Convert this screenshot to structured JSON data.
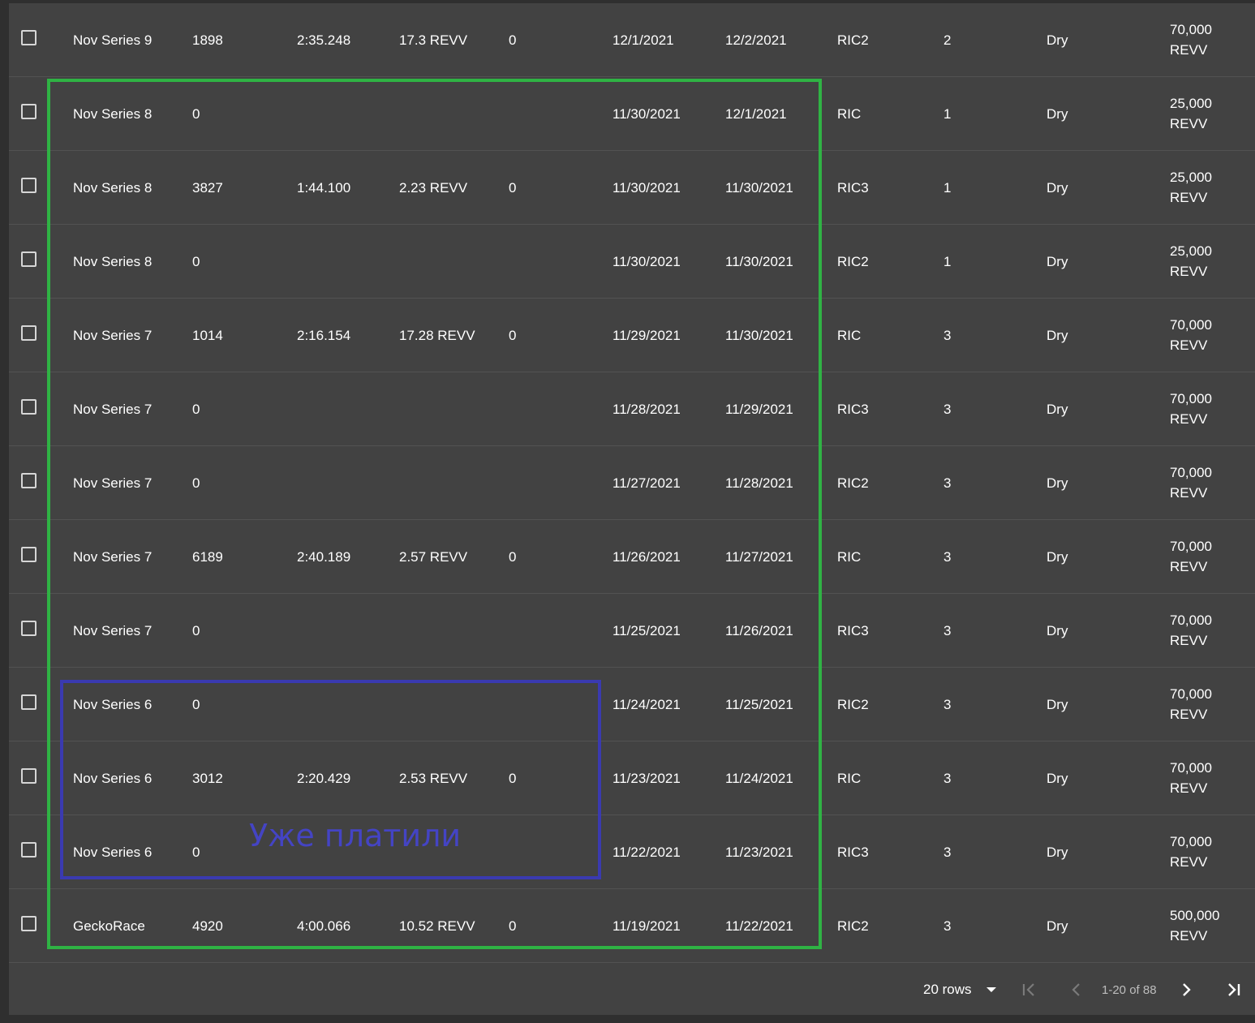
{
  "rows": [
    {
      "name": "Nov Series 9",
      "score": "1898",
      "time": "2:35.248",
      "reward": "17.3 REVV",
      "zero": "0",
      "start": "12/1/2021",
      "end": "12/2/2021",
      "track": "RIC2",
      "laps": "2",
      "weather": "Dry",
      "prize": "70,000 REVV"
    },
    {
      "name": "Nov Series 8",
      "score": "0",
      "time": "",
      "reward": "",
      "zero": "",
      "start": "11/30/2021",
      "end": "12/1/2021",
      "track": "RIC",
      "laps": "1",
      "weather": "Dry",
      "prize": "25,000 REVV"
    },
    {
      "name": "Nov Series 8",
      "score": "3827",
      "time": "1:44.100",
      "reward": "2.23 REVV",
      "zero": "0",
      "start": "11/30/2021",
      "end": "11/30/2021",
      "track": "RIC3",
      "laps": "1",
      "weather": "Dry",
      "prize": "25,000 REVV"
    },
    {
      "name": "Nov Series 8",
      "score": "0",
      "time": "",
      "reward": "",
      "zero": "",
      "start": "11/30/2021",
      "end": "11/30/2021",
      "track": "RIC2",
      "laps": "1",
      "weather": "Dry",
      "prize": "25,000 REVV"
    },
    {
      "name": "Nov Series 7",
      "score": "1014",
      "time": "2:16.154",
      "reward": "17.28 REVV",
      "zero": "0",
      "start": "11/29/2021",
      "end": "11/30/2021",
      "track": "RIC",
      "laps": "3",
      "weather": "Dry",
      "prize": "70,000 REVV"
    },
    {
      "name": "Nov Series 7",
      "score": "0",
      "time": "",
      "reward": "",
      "zero": "",
      "start": "11/28/2021",
      "end": "11/29/2021",
      "track": "RIC3",
      "laps": "3",
      "weather": "Dry",
      "prize": "70,000 REVV"
    },
    {
      "name": "Nov Series 7",
      "score": "0",
      "time": "",
      "reward": "",
      "zero": "",
      "start": "11/27/2021",
      "end": "11/28/2021",
      "track": "RIC2",
      "laps": "3",
      "weather": "Dry",
      "prize": "70,000 REVV"
    },
    {
      "name": "Nov Series 7",
      "score": "6189",
      "time": "2:40.189",
      "reward": "2.57 REVV",
      "zero": "0",
      "start": "11/26/2021",
      "end": "11/27/2021",
      "track": "RIC",
      "laps": "3",
      "weather": "Dry",
      "prize": "70,000 REVV"
    },
    {
      "name": "Nov Series 7",
      "score": "0",
      "time": "",
      "reward": "",
      "zero": "",
      "start": "11/25/2021",
      "end": "11/26/2021",
      "track": "RIC3",
      "laps": "3",
      "weather": "Dry",
      "prize": "70,000 REVV"
    },
    {
      "name": "Nov Series 6",
      "score": "0",
      "time": "",
      "reward": "",
      "zero": "",
      "start": "11/24/2021",
      "end": "11/25/2021",
      "track": "RIC2",
      "laps": "3",
      "weather": "Dry",
      "prize": "70,000 REVV"
    },
    {
      "name": "Nov Series 6",
      "score": "3012",
      "time": "2:20.429",
      "reward": "2.53 REVV",
      "zero": "0",
      "start": "11/23/2021",
      "end": "11/24/2021",
      "track": "RIC",
      "laps": "3",
      "weather": "Dry",
      "prize": "70,000 REVV"
    },
    {
      "name": "Nov Series 6",
      "score": "0",
      "time": "",
      "reward": "",
      "zero": "",
      "start": "11/22/2021",
      "end": "11/23/2021",
      "track": "RIC3",
      "laps": "3",
      "weather": "Dry",
      "prize": "70,000 REVV"
    },
    {
      "name": "GeckoRace",
      "score": "4920",
      "time": "4:00.066",
      "reward": "10.52 REVV",
      "zero": "0",
      "start": "11/19/2021",
      "end": "11/22/2021",
      "track": "RIC2",
      "laps": "3",
      "weather": "Dry",
      "prize": "500,000 REVV"
    }
  ],
  "annotation": {
    "note": "Уже платили",
    "green_color": "#2fb344",
    "blue_color": "#3a3ab0"
  },
  "pagination": {
    "rows_label": "20 rows",
    "page_info": "1-20 of 88",
    "icons": [
      "chevron-down-icon",
      "first-page-icon",
      "prev-page-icon",
      "next-page-icon",
      "last-page-icon"
    ]
  },
  "colors": {
    "table_bg": "#424242",
    "page_bg": "#2f2f2f",
    "text": "#ffffff",
    "row_divider": "#525252"
  }
}
